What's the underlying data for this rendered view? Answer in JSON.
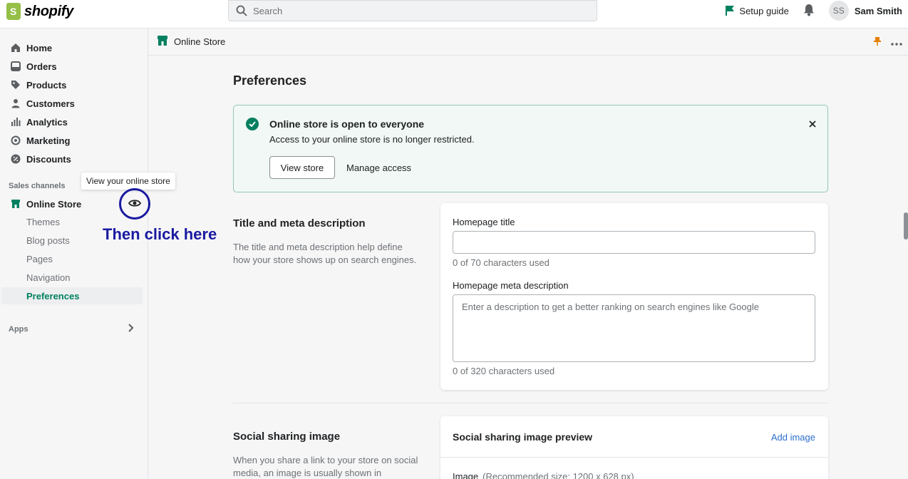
{
  "topbar": {
    "logo_text": "shopify",
    "search_placeholder": "Search",
    "setup_guide": "Setup guide",
    "avatar_initials": "SS",
    "user_name": "Sam Smith"
  },
  "sidebar": {
    "items": [
      {
        "label": "Home",
        "icon": "home-icon"
      },
      {
        "label": "Orders",
        "icon": "orders-icon"
      },
      {
        "label": "Products",
        "icon": "tag-icon"
      },
      {
        "label": "Customers",
        "icon": "person-icon"
      },
      {
        "label": "Analytics",
        "icon": "bar-chart-icon"
      },
      {
        "label": "Marketing",
        "icon": "target-icon"
      },
      {
        "label": "Discounts",
        "icon": "discount-icon"
      }
    ],
    "sales_channels_label": "Sales channels",
    "online_store": "Online Store",
    "sub_items": [
      "Themes",
      "Blog posts",
      "Pages",
      "Navigation",
      "Preferences"
    ],
    "apps_label": "Apps",
    "tooltip": "View your online store",
    "annotation": "Then click here"
  },
  "pagebar": {
    "title": "Online Store"
  },
  "main": {
    "heading": "Preferences",
    "banner": {
      "title": "Online store is open to everyone",
      "message": "Access to your online store is no longer restricted.",
      "view_store": "View store",
      "manage_access": "Manage access"
    },
    "meta_section": {
      "title": "Title and meta description",
      "description": "The title and meta description help define how your store shows up on search engines.",
      "homepage_title_label": "Homepage title",
      "homepage_title_value": "",
      "homepage_title_help": "0 of 70 characters used",
      "meta_desc_label": "Homepage meta description",
      "meta_desc_placeholder": "Enter a description to get a better ranking on search engines like Google",
      "meta_desc_help": "0 of 320 characters used"
    },
    "social_section": {
      "title": "Social sharing image",
      "description": "When you share a link to your store on social media, an image is usually shown in",
      "preview_title": "Social sharing image preview",
      "add_image": "Add image",
      "image_label": "Image",
      "image_recommended": "(Recommended size: 1200 x 628 px)"
    }
  },
  "colors": {
    "accent_green": "#008060",
    "annotation_blue": "#1a1aa0",
    "banner_bg": "#f1f8f5",
    "link_blue": "#2c6ecb"
  }
}
